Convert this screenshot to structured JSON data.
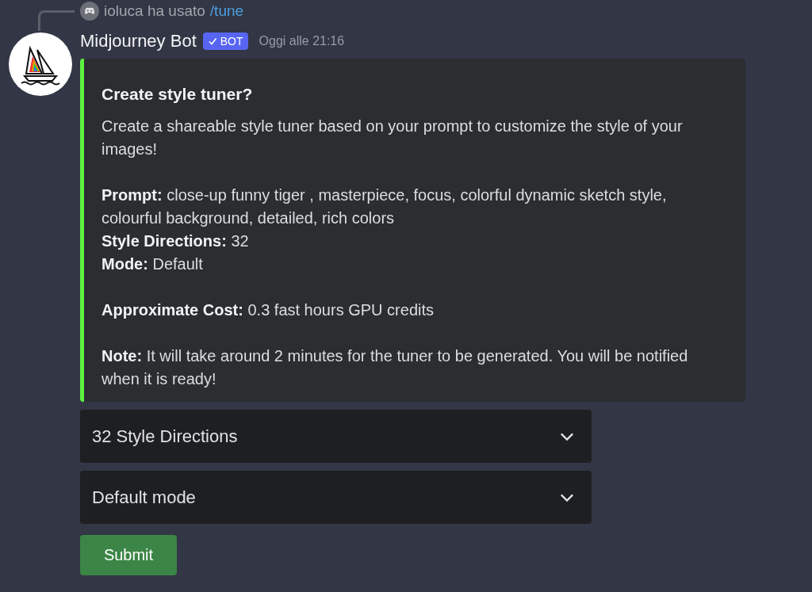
{
  "reply": {
    "user_text": "ioluca ha usato",
    "command": "/tune"
  },
  "message": {
    "author": "Midjourney Bot",
    "badge": "BOT",
    "timestamp": "Oggi alle 21:16"
  },
  "embed": {
    "color": "#5cf13f",
    "title": "Create style tuner?",
    "paragraphs": [
      [
        "Create a shareable style tuner based on your prompt to customize the style of your images!"
      ],
      [
        "**Prompt:** close-up funny tiger , masterpiece, focus, colorful dynamic sketch style, colourful background, detailed, rich colors",
        "**Style Directions:** 32",
        "**Mode:** Default"
      ],
      [
        "**Approximate Cost:** 0.3 fast hours GPU credits"
      ],
      [
        "**Note:** It will take around 2 minutes for the tuner to be generated. You will be notified when it is ready!"
      ]
    ]
  },
  "selects": [
    {
      "value": "32 Style Directions"
    },
    {
      "value": "Default mode"
    }
  ],
  "buttons": [
    {
      "label": "Submit"
    }
  ]
}
